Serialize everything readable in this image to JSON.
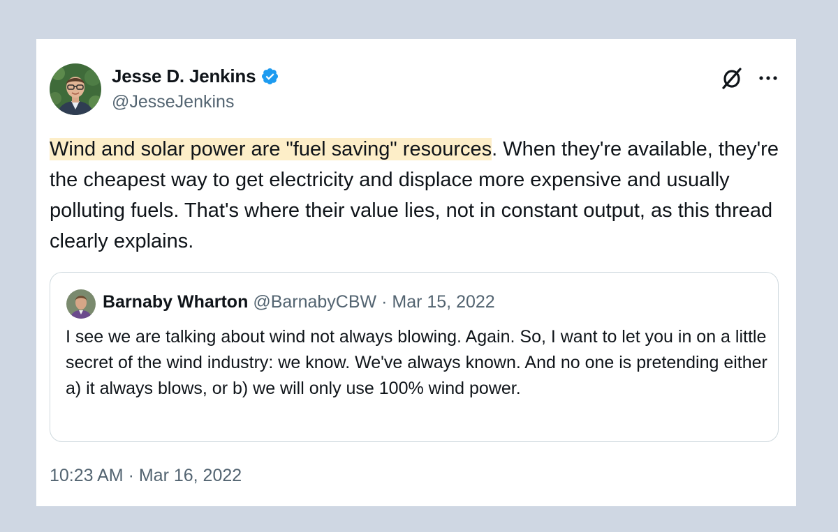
{
  "tweet": {
    "author": {
      "name": "Jesse D. Jenkins",
      "handle": "@JesseJenkins",
      "verified": true,
      "avatar": "profile-photo"
    },
    "text_highlighted": "Wind and solar power are \"fuel saving\" resources",
    "text_rest": ". When they're available, they're the cheapest way to get electricity and displace more expensive and usually polluting fuels. That's where their value lies, not in constant output, as this thread clearly explains.",
    "timestamp": "10:23 AM · Mar 16, 2022",
    "actions": {
      "brand_icon": "x-logo-icon",
      "more_icon": "more-dots-icon"
    }
  },
  "quoted_tweet": {
    "name": "Barnaby Wharton",
    "handle": "@BarnabyCBW",
    "separator": "·",
    "date": "Mar 15, 2022",
    "text": "I see we are talking about wind not always blowing. Again. So, I want to let you in on a little secret of the wind industry: we know. We've always known. And no one is pretending either a) it always blows, or b) we will only use 100% wind power."
  },
  "colors": {
    "background": "#cfd7e3",
    "card": "#ffffff",
    "highlight": "#fdeec8",
    "verified_badge": "#1d9bf0",
    "secondary_text": "#536471",
    "border": "#cfd9de"
  }
}
